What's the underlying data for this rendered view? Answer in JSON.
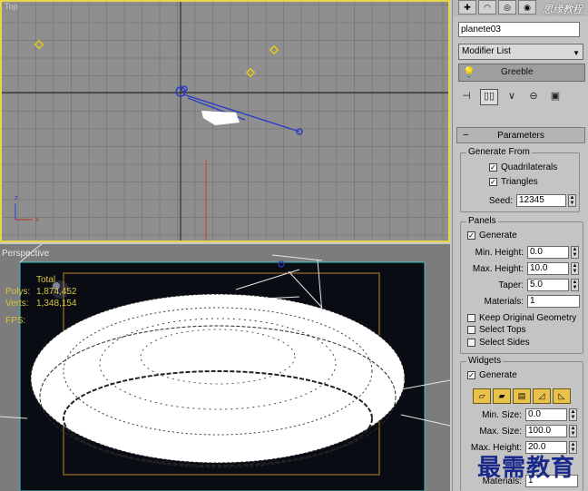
{
  "viewports": {
    "top": {
      "label": "Top"
    },
    "perspective": {
      "label": "Perspective"
    }
  },
  "stats": {
    "total_label": "Total",
    "polys_label": "Polys:",
    "polys_value": "1,874,452",
    "verts_label": "Verts:",
    "verts_value": "1,348,154",
    "fps_label": "FPS:"
  },
  "panel": {
    "watermark_logo": "思缘教程",
    "object_name": "planete03",
    "modifier_list": "Modifier List",
    "stack_item": "Greeble",
    "rollout_title": "Parameters",
    "generate_from": {
      "title": "Generate From",
      "quadrilaterals": "Quadrilaterals",
      "triangles": "Triangles",
      "seed_label": "Seed:",
      "seed_value": "12345"
    },
    "panels": {
      "title": "Panels",
      "generate": "Generate",
      "min_height_label": "Min. Height:",
      "min_height_value": "0.0",
      "max_height_label": "Max. Height:",
      "max_height_value": "10.0",
      "taper_label": "Taper:",
      "taper_value": "5.0",
      "materials_label": "Materials:",
      "materials_value": "1",
      "keep_original": "Keep Original Geometry",
      "select_tops": "Select Tops",
      "select_sides": "Select Sides"
    },
    "widgets": {
      "title": "Widgets",
      "generate": "Generate",
      "min_size_label": "Min. Size:",
      "min_size_value": "0.0",
      "max_size_label": "Max. Size:",
      "max_size_value": "100.0",
      "max_height_label": "Max. Height:",
      "max_height_value": "20.0",
      "materials_label": "Materials:",
      "materials_value": "1"
    }
  },
  "watermark": "最需教育",
  "colors": {
    "selection": "#e9d54a",
    "gizmo_blue": "#2a3cc8",
    "stats": "#d8c53a"
  }
}
